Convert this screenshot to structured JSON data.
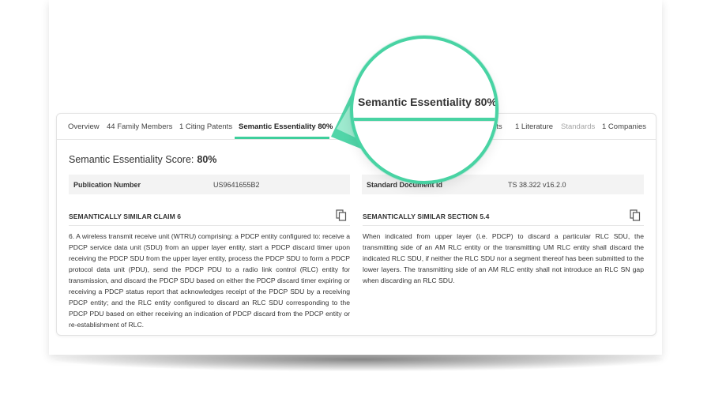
{
  "tabs": [
    {
      "label": "Overview",
      "state": "normal"
    },
    {
      "label": "44 Family Members",
      "state": "normal"
    },
    {
      "label": "1 Citing Patents",
      "state": "normal"
    },
    {
      "label": "Semantic Essentiality 80%",
      "state": "active"
    },
    {
      "label": "nts",
      "state": "normal"
    },
    {
      "label": "1 Literature",
      "state": "normal"
    },
    {
      "label": "Standards",
      "state": "muted"
    },
    {
      "label": "1 Companies",
      "state": "normal"
    }
  ],
  "score": {
    "label": "Semantic Essentiality Score:",
    "value": "80%"
  },
  "left": {
    "field_label": "Publication Number",
    "field_value": "US9641655B2",
    "section_title": "SEMANTICALLY SIMILAR CLAIM 6",
    "text": "6. A wireless transmit receive unit (WTRU) comprising: a PDCP entity configured to: receive a PDCP service data unit (SDU) from an upper layer entity, start a PDCP discard timer upon receiving the PDCP SDU from the upper layer entity, process the PDCP SDU to form a PDCP protocol data unit (PDU), send the PDCP PDU to a radio link control (RLC) entity for transmission, and discard the PDCP SDU based on either the PDCP discard timer expiring or receiving a PDCP status report that acknowledges receipt of the PDCP SDU by a receiving PDCP entity; and the RLC entity configured to discard an RLC SDU corresponding to the PDCP PDU based on either receiving an indication of PDCP discard from the PDCP entity or re-establishment of RLC."
  },
  "right": {
    "field_label": "Standard Document Id",
    "field_value": "TS 38.322 v16.2.0",
    "section_title": "SEMANTICALLY SIMILAR SECTION 5.4",
    "text": "When indicated from upper layer (i.e. PDCP) to discard a particular RLC SDU, the transmitting side of an AM RLC entity or the transmitting UM RLC entity shall discard the indicated RLC SDU, if neither the RLC SDU nor a segment thereof has been submitted to the lower layers. The transmitting side of an AM RLC entity shall not introduce an RLC SN gap when discarding an RLC SDU."
  },
  "magnifier": {
    "label": "Semantic Essentiality 80%"
  },
  "icons": {
    "copy": "copy-icon"
  },
  "colors": {
    "accent": "#3ecf9c",
    "magnifier_ring": "#48d3a3"
  }
}
